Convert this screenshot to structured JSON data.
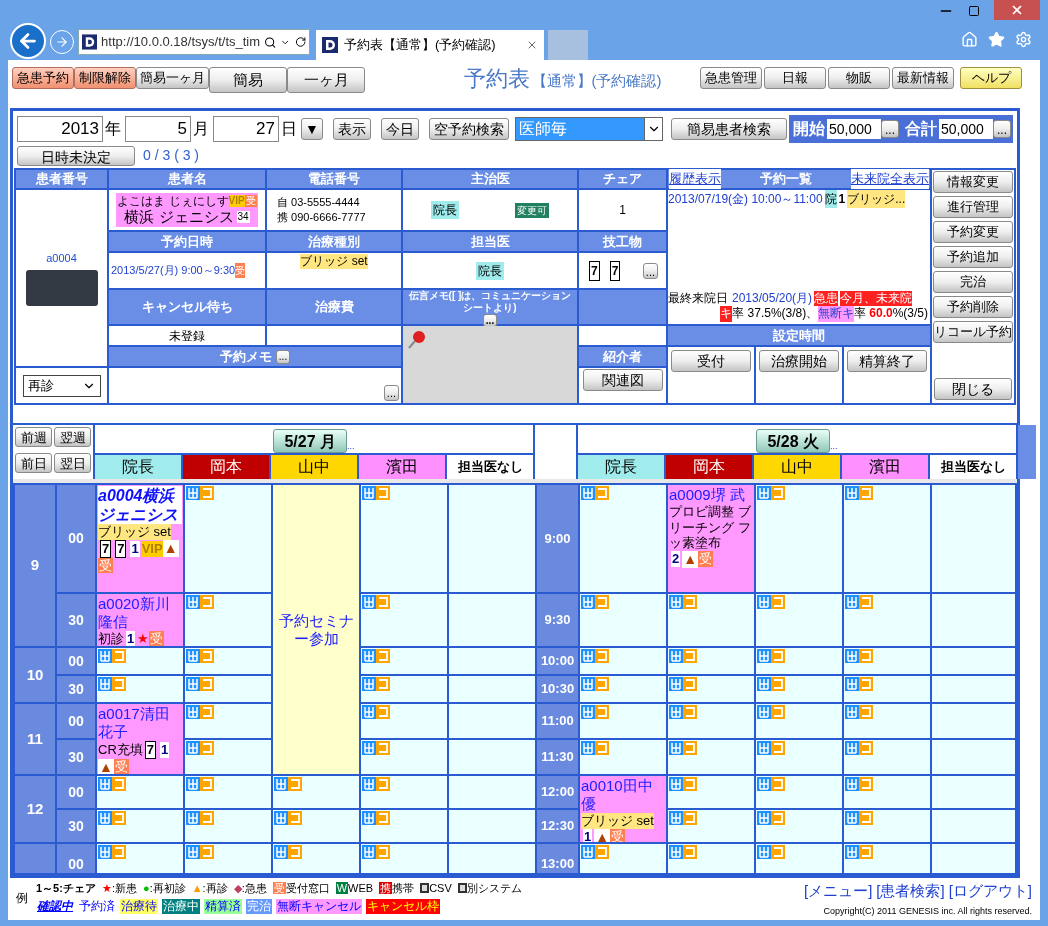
{
  "browser": {
    "url": "http://10.0.0.18/tsys/t/ts_tim",
    "tab_title": "予約表【通常】(予約確認)"
  },
  "toolbar": {
    "left_buttons": [
      {
        "label": "急患予約",
        "kind": "alert"
      },
      {
        "label": "制限解除",
        "kind": "alert"
      },
      {
        "label": "簡易一ヶ月",
        "kind": "small"
      },
      {
        "label": "簡易",
        "kind": "large"
      },
      {
        "label": "一ヶ月",
        "kind": "large"
      }
    ],
    "title": "予約表",
    "subtitle": "【通常】(予約確認)",
    "right_buttons": [
      {
        "label": "急患管理",
        "kind": "plain"
      },
      {
        "label": "日報",
        "kind": "plain"
      },
      {
        "label": "物販",
        "kind": "plain"
      },
      {
        "label": "最新情報",
        "kind": "plain"
      },
      {
        "label": "ヘルプ",
        "kind": "help"
      }
    ]
  },
  "date_bar": {
    "fields": [
      {
        "value": "2013",
        "unit": "年"
      },
      {
        "value": "5",
        "unit": "月"
      },
      {
        "value": "27",
        "unit": "日"
      }
    ],
    "actions": [
      {
        "label": "▼",
        "kind": "dropdown"
      },
      {
        "label": "表示",
        "kind": "button"
      },
      {
        "label": "今日",
        "kind": "button"
      },
      {
        "label": "空予約検索",
        "kind": "button"
      }
    ],
    "doctor_select": "医師毎",
    "patient_search": "簡易患者検索",
    "totals": [
      {
        "label": "開始",
        "value": "50,000",
        "more": "..."
      },
      {
        "label": "合計",
        "value": "50,000",
        "more": "..."
      }
    ],
    "undecided": "日時未決定",
    "count": "0 / 3 ( 3 )"
  },
  "patient": {
    "id_header": "患者番号",
    "id": "a0004",
    "visit_type": "再診",
    "name_header": "患者名",
    "kana": "よこはま じぇにしす",
    "badges": [
      {
        "text": "VIP",
        "kind": "vip"
      },
      {
        "text": "受",
        "kind": "reception"
      }
    ],
    "name": "横浜 ジェニシス",
    "age": "34",
    "phone_header": "電話番号",
    "phones": [
      "自 03-5555-4444",
      "携 090-6666-7777"
    ],
    "doctor_header": "主治医",
    "doctor": "院長",
    "doctor_tag": "変更可",
    "chair_header": "チェア",
    "chair": "1",
    "date_header": "予約日時",
    "date": "2013/5/27(月) 9:00～9:30",
    "date_badge": "受",
    "treatment_header": "治療種別",
    "treatment": "ブリッジ set",
    "assigned_header": "担当医",
    "assigned": "院長",
    "lab_header": "技工物",
    "lab_teeth": [
      "7",
      "7"
    ],
    "lab_more": "...",
    "cancel_wait_header": "キャンセル待ち",
    "cancel_wait": "未登録",
    "fee_header": "治療費",
    "message_header": "伝言メモ([ ]は、コミュニケーションシートより)",
    "message_more": "...",
    "memo_header": "予約メモ",
    "memo_more": "...",
    "memo_field_more": "...",
    "referrer_header": "紹介者",
    "relation_button": "関連図",
    "history_link": "履歴表示",
    "list_header": "予約一覧",
    "future_link": "未来院全表示",
    "upcoming": {
      "datetime": "2013/07/19(金) 10:00～11:00",
      "doctor": "院",
      "chair": "1",
      "treatment": "ブリッジ..."
    },
    "last_visit_label": "最終来院日",
    "last_visit": "2013/05/20(月)",
    "last_visit_tags": [
      "急患",
      "今月、未来院"
    ],
    "cancel_tag": "キ",
    "cancel_rate": "率 37.5%(3/8)、",
    "noshow_tag": "無断キ",
    "noshow_label": "率",
    "noshow_value": "60.0",
    "noshow_detail": "%(3/5)",
    "time_header": "設定時間",
    "time_buttons": [
      "受付",
      "治療開始",
      "精算終了"
    ],
    "side_buttons": [
      "情報変更",
      "進行管理",
      "予約変更",
      "予約追加",
      "完治",
      "予約削除",
      "リコール予約"
    ],
    "close_button": "閉じる"
  },
  "schedule": {
    "nav": [
      "前週",
      "翌週",
      "前日",
      "翌日"
    ],
    "hours": [
      {
        "label": "9",
        "rows": [
          {
            "minute": "00",
            "time": "9:00"
          },
          {
            "minute": "30",
            "time": "9:30"
          }
        ]
      },
      {
        "label": "10",
        "rows": [
          {
            "minute": "00",
            "time": "10:00"
          },
          {
            "minute": "30",
            "time": "10:30"
          }
        ]
      },
      {
        "label": "11",
        "rows": [
          {
            "minute": "00",
            "time": "11:00"
          },
          {
            "minute": "30",
            "time": "11:30"
          }
        ]
      },
      {
        "label": "12",
        "rows": [
          {
            "minute": "00",
            "time": "12:00"
          },
          {
            "minute": "30",
            "time": "12:30"
          }
        ]
      },
      {
        "rows": [
          {
            "minute": "00",
            "time": "13:00"
          }
        ]
      }
    ],
    "days": [
      {
        "date": "5/27 月",
        "more": "...",
        "doctors": [
          {
            "name": "院長",
            "color": "#a0ecec",
            "cells": [
              {
                "kind": "appointment",
                "confirming": true,
                "label": "a0004横浜ジェニシス",
                "treatment": "ブリッジ set",
                "highlight": true,
                "marks": [
                  {
                    "kind": "tooth",
                    "text": "7"
                  },
                  {
                    "kind": "tooth",
                    "text": "7"
                  },
                  {
                    "kind": "chair",
                    "text": "1"
                  },
                  {
                    "kind": "vip",
                    "text": "VIP"
                  },
                  {
                    "kind": "revisit",
                    "text": "▲"
                  },
                  {
                    "kind": "reception",
                    "text": "受"
                  }
                ]
              },
              {
                "kind": "appointment",
                "confirming": false,
                "label": "a0020新川隆信",
                "treatment": "初診",
                "highlight": false,
                "marks": [
                  {
                    "kind": "chair",
                    "text": "1"
                  },
                  {
                    "kind": "new",
                    "text": "★"
                  },
                  {
                    "kind": "reception",
                    "text": "受"
                  }
                ]
              },
              {
                "kind": "slot"
              },
              {
                "kind": "slot"
              },
              {
                "kind": "appointment",
                "confirming": false,
                "label": "a0017清田花子",
                "treatment": "CR充填",
                "highlight": false,
                "marks": [
                  {
                    "kind": "tooth",
                    "text": "7"
                  },
                  {
                    "kind": "chair",
                    "text": "1"
                  },
                  {
                    "kind": "revisit",
                    "text": "▲"
                  },
                  {
                    "kind": "reception",
                    "text": "受"
                  }
                ]
              },
              {
                "kind": "covered"
              },
              {
                "kind": "slot"
              },
              {
                "kind": "slot"
              },
              {
                "kind": "slot"
              }
            ]
          },
          {
            "name": "岡本",
            "color": "#c00000",
            "cells": [
              {
                "kind": "slot"
              },
              {
                "kind": "slot"
              },
              {
                "kind": "slot"
              },
              {
                "kind": "slot"
              },
              {
                "kind": "slot"
              },
              {
                "kind": "slot"
              },
              {
                "kind": "slot"
              },
              {
                "kind": "slot"
              },
              {
                "kind": "slot"
              }
            ]
          },
          {
            "name": "山中",
            "color": "#ffd700",
            "cells": [
              {
                "kind": "event",
                "text": "予約セミナー参加"
              },
              {
                "kind": "covered"
              },
              {
                "kind": "covered"
              },
              {
                "kind": "covered"
              },
              {
                "kind": "covered"
              },
              {
                "kind": "covered"
              },
              {
                "kind": "slot"
              },
              {
                "kind": "slot"
              },
              {
                "kind": "slot"
              }
            ]
          },
          {
            "name": "濱田",
            "color": "#ff90ff",
            "cells": [
              {
                "kind": "slot"
              },
              {
                "kind": "slot"
              },
              {
                "kind": "slot"
              },
              {
                "kind": "slot"
              },
              {
                "kind": "slot"
              },
              {
                "kind": "slot"
              },
              {
                "kind": "slot"
              },
              {
                "kind": "slot"
              },
              {
                "kind": "slot"
              }
            ]
          },
          {
            "name": "担当医なし",
            "color": "#ffffff",
            "cells": [
              {
                "kind": "empty"
              },
              {
                "kind": "empty"
              },
              {
                "kind": "empty"
              },
              {
                "kind": "empty"
              },
              {
                "kind": "empty"
              },
              {
                "kind": "empty"
              },
              {
                "kind": "empty"
              },
              {
                "kind": "empty"
              },
              {
                "kind": "empty"
              }
            ]
          }
        ]
      },
      {
        "date": "5/28 火",
        "more": "...",
        "doctors": [
          {
            "name": "院長",
            "color": "#a0ecec",
            "cells": [
              {
                "kind": "slot"
              },
              {
                "kind": "slot"
              },
              {
                "kind": "slot"
              },
              {
                "kind": "slot"
              },
              {
                "kind": "slot"
              },
              {
                "kind": "slot"
              },
              {
                "kind": "appointment",
                "confirming": false,
                "label": "a0010田中優",
                "treatment": "ブリッジ set",
                "highlight": true,
                "marks": [
                  {
                    "kind": "chair",
                    "text": "1"
                  },
                  {
                    "kind": "revisit",
                    "text": "▲"
                  },
                  {
                    "kind": "reception",
                    "text": "受"
                  }
                ]
              },
              {
                "kind": "covered"
              },
              {
                "kind": "slot"
              }
            ]
          },
          {
            "name": "岡本",
            "color": "#c00000",
            "cells": [
              {
                "kind": "appointment",
                "confirming": false,
                "label": "a0009堺 武",
                "treatment": "プロビ調整 ブリーチング フッ素塗布",
                "highlight": false,
                "marks": [
                  {
                    "kind": "chair",
                    "text": "2"
                  },
                  {
                    "kind": "revisit",
                    "text": "▲"
                  },
                  {
                    "kind": "reception",
                    "text": "受"
                  }
                ]
              },
              {
                "kind": "slot"
              },
              {
                "kind": "slot"
              },
              {
                "kind": "slot"
              },
              {
                "kind": "slot"
              },
              {
                "kind": "slot"
              },
              {
                "kind": "slot"
              },
              {
                "kind": "slot"
              },
              {
                "kind": "slot"
              }
            ]
          },
          {
            "name": "山中",
            "color": "#ffd700",
            "cells": [
              {
                "kind": "slot"
              },
              {
                "kind": "slot"
              },
              {
                "kind": "slot"
              },
              {
                "kind": "slot"
              },
              {
                "kind": "slot"
              },
              {
                "kind": "slot"
              },
              {
                "kind": "slot"
              },
              {
                "kind": "slot"
              },
              {
                "kind": "slot"
              }
            ]
          },
          {
            "name": "濱田",
            "color": "#ff90ff",
            "cells": [
              {
                "kind": "slot"
              },
              {
                "kind": "slot"
              },
              {
                "kind": "slot"
              },
              {
                "kind": "slot"
              },
              {
                "kind": "slot"
              },
              {
                "kind": "slot"
              },
              {
                "kind": "slot"
              },
              {
                "kind": "slot"
              },
              {
                "kind": "slot"
              }
            ]
          },
          {
            "name": "担当医なし",
            "color": "#ffffff",
            "cells": [
              {
                "kind": "empty"
              },
              {
                "kind": "empty"
              },
              {
                "kind": "empty"
              },
              {
                "kind": "empty"
              },
              {
                "kind": "empty"
              },
              {
                "kind": "empty"
              },
              {
                "kind": "empty"
              },
              {
                "kind": "empty"
              },
              {
                "kind": "empty"
              }
            ]
          }
        ]
      }
    ]
  },
  "legend": {
    "label": "例",
    "items": [
      {
        "kind": "text",
        "text": "1～5:チェア"
      },
      {
        "kind": "symbol",
        "symbol": "★",
        "color": "#ff0000",
        "text": ":新患"
      },
      {
        "kind": "symbol",
        "symbol": "●",
        "color": "#00c000",
        "text": ":再初診"
      },
      {
        "kind": "symbol",
        "symbol": "▲",
        "color": "#ff9900",
        "text": ":再診"
      },
      {
        "kind": "symbol",
        "symbol": "◆",
        "color": "#c04060",
        "text": ":急患"
      },
      {
        "kind": "badge",
        "symbol": "受",
        "color": "#ff7f50",
        "text": "受付窓口"
      },
      {
        "kind": "badge",
        "symbol": "W",
        "color": "#008040",
        "text": "WEB"
      },
      {
        "kind": "badge",
        "symbol": "携",
        "color": "#e00000",
        "text": "携帯"
      },
      {
        "kind": "icon",
        "text": "CSV"
      },
      {
        "kind": "icon",
        "text": "別システム"
      }
    ],
    "statuses": [
      {
        "kind": "emphasis",
        "text": "確認中",
        "color": "#ffffff"
      },
      {
        "kind": "light",
        "text": "予約済",
        "color": "#ffffff"
      },
      {
        "kind": "light",
        "text": "治療待",
        "color": "#ffff66"
      },
      {
        "kind": "dark",
        "text": "治療中",
        "color": "#008080"
      },
      {
        "kind": "light",
        "text": "精算済",
        "color": "#99ff99"
      },
      {
        "kind": "dark",
        "text": "完治",
        "color": "#6699ff"
      },
      {
        "kind": "light",
        "text": "無断キャンセル",
        "color": "#ff99ff"
      },
      {
        "kind": "alert",
        "text": "キャンセル枠",
        "color": "#ff0000"
      }
    ]
  },
  "footer": {
    "links": [
      "[メニュー]",
      "[患者検索]",
      "[ログアウト]"
    ],
    "copyright": "Copyright(C) 2011 GENESIS inc. All rights reserved."
  }
}
